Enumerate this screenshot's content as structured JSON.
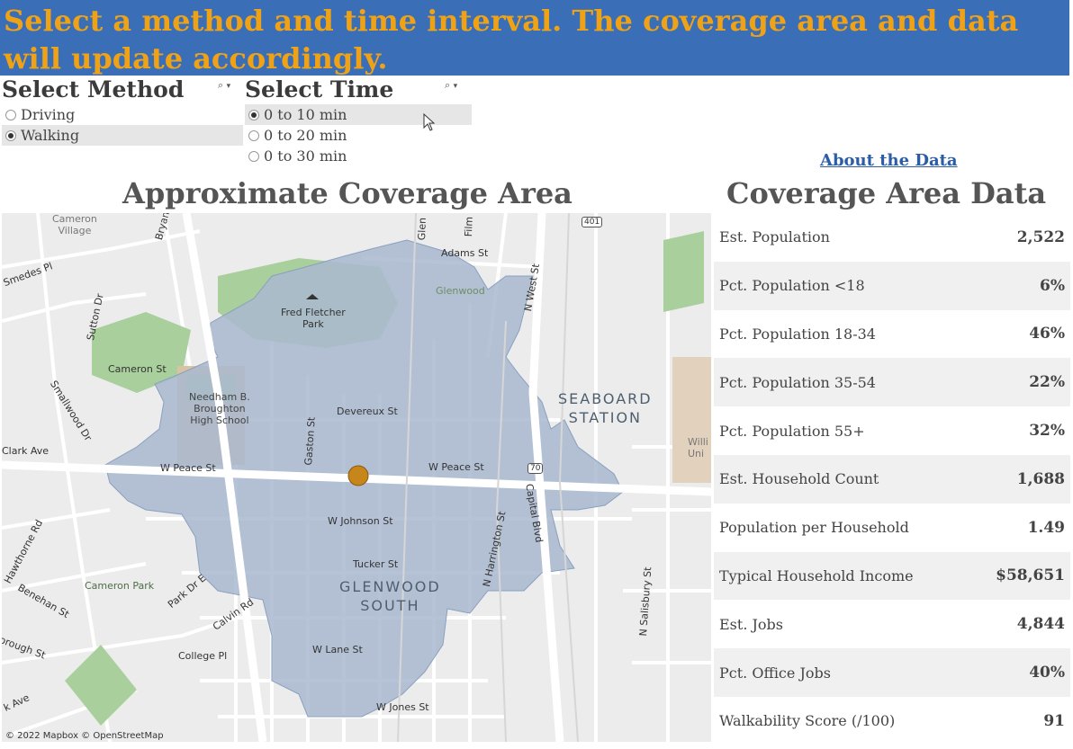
{
  "banner": {
    "text": "Select a method and time interval. The coverage area and data will update accordingly."
  },
  "method_filter": {
    "title": "Select Method",
    "options": [
      {
        "label": "Driving",
        "selected": false
      },
      {
        "label": "Walking",
        "selected": true
      }
    ]
  },
  "time_filter": {
    "title": "Select Time",
    "options": [
      {
        "label": "0 to 10 min",
        "selected": true
      },
      {
        "label": "0 to 20 min",
        "selected": false
      },
      {
        "label": "0 to 30 min",
        "selected": false
      }
    ]
  },
  "about_link": "About the Data",
  "map_section": {
    "title": "Approximate Coverage Area",
    "credit": "© 2022 Mapbox © OpenStreetMap",
    "labels": {
      "cameron_village": "Cameron\nVillage",
      "bryan": "Bryan",
      "glen": "Glen",
      "film": "Film",
      "adams_st": "Adams St",
      "route_401": "401",
      "n_west_st": "N West St",
      "smedes_pl": "Smedes Pl",
      "sutton_dr": "Sutton Dr",
      "fred_fletcher_park": "Fred Fletcher\nPark",
      "glenwood": "Glenwood",
      "cameron_st": "Cameron St",
      "smallwood_dr": "Smallwood Dr",
      "needham": "Needham B.\nBroughton\nHigh School",
      "devereux_st": "Devereux St",
      "seaboard_station": "SEABOARD\nSTATION",
      "gaston_st": "Gaston St",
      "clark_ave": "Clark Ave",
      "w_peace_st_left": "W Peace St",
      "w_peace_st_right": "W Peace St",
      "route_70": "70",
      "capital_blvd": "Capital Blvd",
      "willi": "Willi\nUni",
      "w_johnson_st": "W Johnson St",
      "n_harrington_st": "N Harrington St",
      "hawthorne_rd": "Hawthorne Rd",
      "benehan_st": "Benehan St",
      "cameron_park": "Cameron Park",
      "park_dr_e": "Park Dr E",
      "tucker_st": "Tucker St",
      "glenwood_south": "GLENWOOD\nSOUTH",
      "calvin_rd": "Calvin Rd",
      "n_salisbury_st": "N Salisbury St",
      "borough_st": "orough St",
      "college_pl": "College Pl",
      "w_lane_st": "W Lane St",
      "k_ave": "k Ave",
      "w_jones_st": "W Jones St"
    }
  },
  "data_section": {
    "title": "Coverage Area Data",
    "rows": [
      {
        "label": "Est. Population",
        "value": "2,522"
      },
      {
        "label": "Pct. Population <18",
        "value": "6%"
      },
      {
        "label": "Pct. Population 18-34",
        "value": "46%"
      },
      {
        "label": "Pct. Population 35-54",
        "value": "22%"
      },
      {
        "label": "Pct. Population 55+",
        "value": "32%"
      },
      {
        "label": "Est. Household Count",
        "value": "1,688"
      },
      {
        "label": "Population per Household",
        "value": "1.49"
      },
      {
        "label": "Typical Household Income",
        "value": "$58,651"
      },
      {
        "label": "Est. Jobs",
        "value": "4,844"
      },
      {
        "label": "Pct. Office Jobs",
        "value": "40%"
      },
      {
        "label": "Walkability Score (/100)",
        "value": "91"
      }
    ]
  },
  "colors": {
    "banner_bg": "#3a6fb8",
    "banner_text": "#f0a216",
    "coverage_fill": "#a9b9cf",
    "park_green": "#a8cf9c",
    "center_marker": "#c7861a",
    "link": "#2a5ca8"
  },
  "icons": {
    "filter_search": "search-icon",
    "filter_menu": "dropdown-arrow-icon",
    "cursor": "mouse-pointer-icon"
  }
}
